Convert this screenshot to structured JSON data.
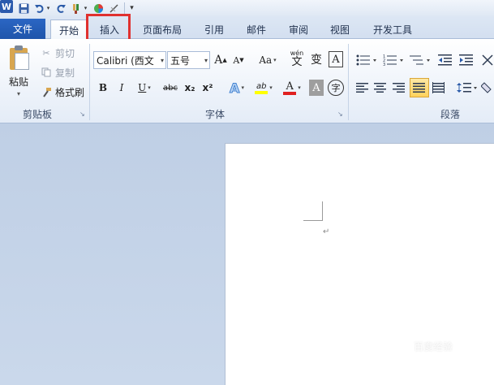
{
  "quick_access": {
    "app_icon": "W",
    "items": [
      "save-icon",
      "undo-icon",
      "undo-dropdown-icon",
      "redo-icon",
      "format-painter-icon",
      "color-icon",
      "draw-icon",
      "customize-icon"
    ]
  },
  "tabs": {
    "file": "文件",
    "items": [
      {
        "label": "开始",
        "active": true
      },
      {
        "label": "插入",
        "active": false,
        "highlighted": true
      },
      {
        "label": "页面布局",
        "active": false
      },
      {
        "label": "引用",
        "active": false
      },
      {
        "label": "邮件",
        "active": false
      },
      {
        "label": "审阅",
        "active": false
      },
      {
        "label": "视图",
        "active": false
      },
      {
        "label": "开发工具",
        "active": false
      }
    ]
  },
  "clipboard": {
    "label": "剪贴板",
    "paste": "粘贴",
    "cut": "剪切",
    "copy": "复制",
    "format_painter": "格式刷"
  },
  "font": {
    "label": "字体",
    "font_name": "Calibri (西文",
    "font_size": "五号",
    "grow": "A",
    "shrink": "A",
    "change_case": "Aa",
    "bold": "B",
    "italic": "I",
    "underline": "U",
    "strikethrough": "abc",
    "subscript": "x₂",
    "superscript": "x²",
    "text_effect": "A",
    "highlight": "ab",
    "font_color": "A",
    "char_shading": "A",
    "enclose": "字",
    "phonetic": "wén",
    "phonetic_char": "文",
    "border_char": "A",
    "highlight_color": "#ffff00",
    "font_color_value": "#e02020"
  },
  "paragraph": {
    "label": "段落"
  },
  "watermark": "百度经验"
}
